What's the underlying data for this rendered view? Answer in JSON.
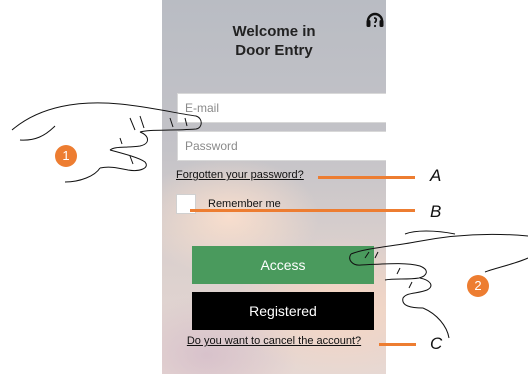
{
  "screen": {
    "title_line1": "Welcome in",
    "title_line2": "Door Entry",
    "email_placeholder": "E-mail",
    "password_placeholder": "Password",
    "forgot_password": "Forgotten your password?",
    "remember_me": "Remember me",
    "access_button": "Access",
    "registered_button": "Registered",
    "cancel_account": "Do you want to cancel the account?",
    "help_icon": "headset-icon"
  },
  "callouts": {
    "a": "A",
    "b": "B",
    "c": "C"
  },
  "steps": {
    "one": "1",
    "two": "2"
  },
  "colors": {
    "accent_orange": "#ed7d31",
    "access_green": "#4a9a5d",
    "registered_black": "#000000"
  }
}
